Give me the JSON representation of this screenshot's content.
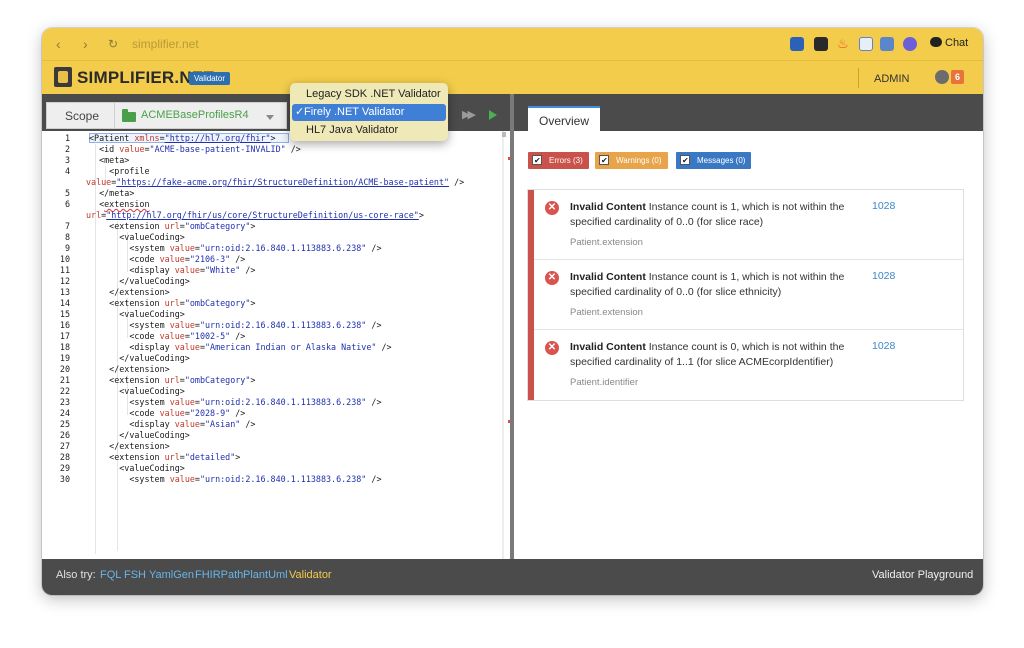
{
  "browser": {
    "url": "simplifier.net",
    "nav": {
      "back": "‹",
      "forward": "›",
      "reload": "↻"
    },
    "chat_label": "Chat",
    "extensions": [
      "tab-icon",
      "bookmark-icon",
      "puzzle-icon",
      "doc-icon",
      "translate-icon",
      "shield-icon"
    ]
  },
  "header": {
    "brand": "SIMPLIFIER.NET",
    "badge": "Validator",
    "user": "ADMIN",
    "notification_count": "6"
  },
  "toolbar": {
    "scope_label": "Scope",
    "scope_value": "ACMEBaseProfilesR4"
  },
  "validator_menu": {
    "items": [
      {
        "label": "Legacy SDK .NET Validator",
        "selected": false
      },
      {
        "label": "Firely .NET Validator",
        "selected": true
      },
      {
        "label": "HL7 Java Validator",
        "selected": false
      }
    ],
    "check": "✓"
  },
  "editor": {
    "line_numbers": [
      "1",
      "2",
      "3",
      "4",
      "",
      "5",
      "6",
      "",
      "7",
      "8",
      "9",
      "10",
      "11",
      "12",
      "13",
      "14",
      "15",
      "16",
      "17",
      "18",
      "19",
      "20",
      "21",
      "22",
      "23",
      "24",
      "25",
      "26",
      "27",
      "28",
      "29",
      "30"
    ]
  },
  "tabs": {
    "overview": "Overview"
  },
  "filters": {
    "errors": "Errors (3)",
    "warnings": "Warnings (0)",
    "messages": "Messages (0)"
  },
  "issues": [
    {
      "title": "Invalid Content",
      "text": "Instance count is 1, which is not within the specified cardinality of 0..0 (for slice race)",
      "path": "Patient.extension",
      "line": "1028"
    },
    {
      "title": "Invalid Content",
      "text": "Instance count is 1, which is not within the specified cardinality of 0..0 (for slice ethnicity)",
      "path": "Patient.extension",
      "line": "1028"
    },
    {
      "title": "Invalid Content",
      "text": "Instance count is 0, which is not within the specified cardinality of 1..1 (for slice ACMEcorpIdentifier)",
      "path": "Patient.identifier",
      "line": "1028"
    }
  ],
  "footer": {
    "also_try": "Also try:",
    "links": [
      "FQL",
      "FSH",
      "YamlGen",
      "FHIRPath",
      "PlantUml",
      "Validator"
    ],
    "right": "Validator Playground"
  },
  "colors": {
    "brand_yellow": "#f2cc4a",
    "toolbar_gray": "#4b4b4b",
    "error_red": "#c9524b",
    "warning_orange": "#e8a44a",
    "message_blue": "#3a78c4",
    "link_blue": "#3a87c8"
  }
}
